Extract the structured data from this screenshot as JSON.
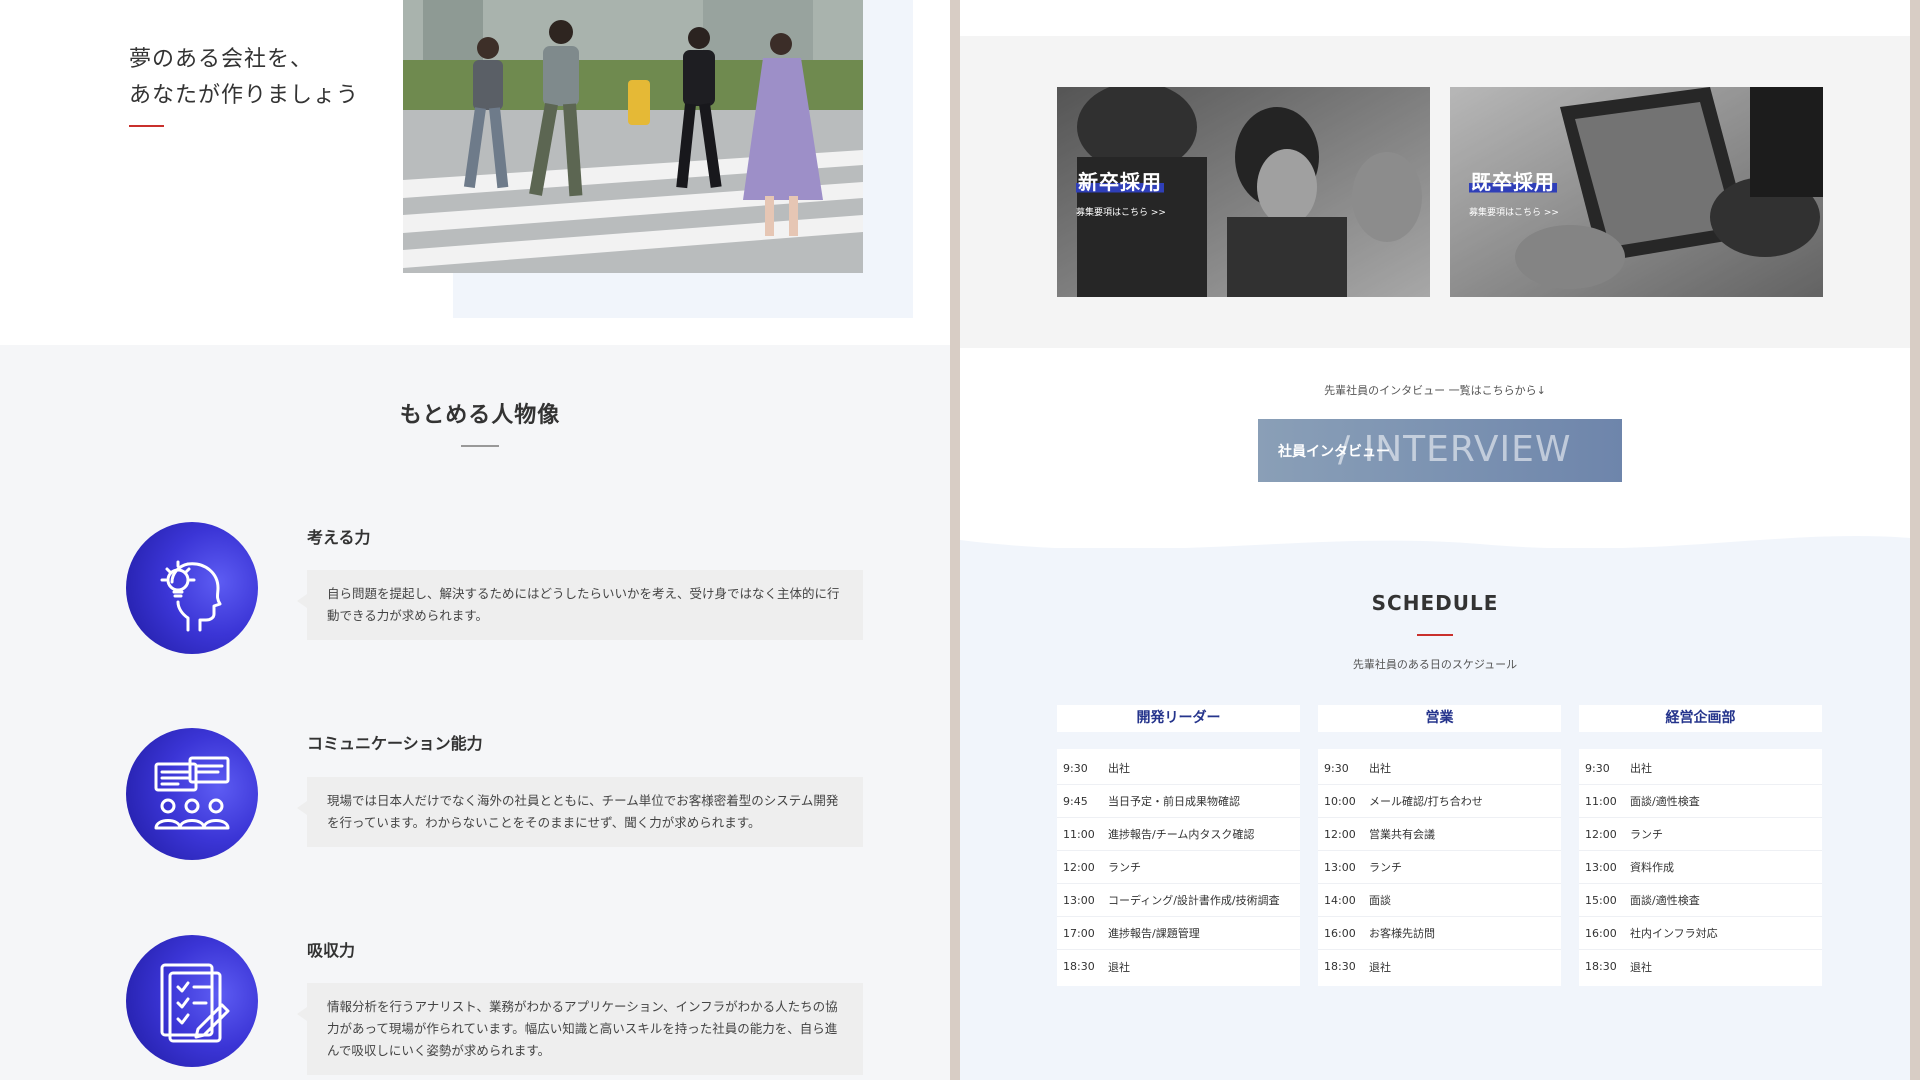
{
  "left": {
    "hero": {
      "title_line1": "夢のある会社を、",
      "title_line2": "あなたが作りましょう"
    },
    "section_title": "もとめる人物像",
    "traits": [
      {
        "name": "考える力",
        "icon": "lightbulb-head-icon",
        "text": "自ら問題を提起し、解決するためにはどうしたらいいかを考え、受け身ではなく主体的に行動できる力が求められます。"
      },
      {
        "name": "コミュニケーション能力",
        "icon": "group-chat-icon",
        "text": "現場では日本人だけでなく海外の社員とともに、チーム単位でお客様密着型のシステム開発を行っています。わからないことをそのままにせず、聞く力が求められます。"
      },
      {
        "name": "吸収力",
        "icon": "checklist-pen-icon",
        "text": "情報分析を行うアナリスト、業務がわかるアプリケーション、インフラがわかる人たちの協力があって現場が作られています。幅広い知識と高いスキルを持った社員の能力を、自ら進んで吸収しにいく姿勢が求められます。"
      }
    ]
  },
  "right": {
    "recruit": [
      {
        "label": "新卒採用",
        "sub": "募集要項はこちら >>"
      },
      {
        "label": "既卒採用",
        "sub": "募集要項はこちら >>"
      }
    ],
    "interview": {
      "note": "先輩社員のインタビュー 一覧はこちらから↓",
      "button_label": "社員インタビュー",
      "button_big": "/ INTERVIEW"
    },
    "schedule": {
      "title": "SCHEDULE",
      "subtitle": "先輩社員のある日のスケジュール",
      "columns": [
        {
          "title": "開発リーダー",
          "rows": [
            {
              "time": "9:30",
              "event": "出社"
            },
            {
              "time": "9:45",
              "event": "当日予定・前日成果物確認"
            },
            {
              "time": "11:00",
              "event": "進捗報告/チーム内タスク確認"
            },
            {
              "time": "12:00",
              "event": "ランチ"
            },
            {
              "time": "13:00",
              "event": "コーディング/設計書作成/技術調査"
            },
            {
              "time": "17:00",
              "event": "進捗報告/課題管理"
            },
            {
              "time": "18:30",
              "event": "退社"
            }
          ]
        },
        {
          "title": "営業",
          "rows": [
            {
              "time": "9:30",
              "event": "出社"
            },
            {
              "time": "10:00",
              "event": "メール確認/打ち合わせ"
            },
            {
              "time": "12:00",
              "event": "営業共有会議"
            },
            {
              "time": "13:00",
              "event": "ランチ"
            },
            {
              "time": "14:00",
              "event": "面談"
            },
            {
              "time": "16:00",
              "event": "お客様先訪問"
            },
            {
              "time": "18:30",
              "event": "退社"
            }
          ]
        },
        {
          "title": "経営企画部",
          "rows": [
            {
              "time": "9:30",
              "event": "出社"
            },
            {
              "time": "11:00",
              "event": "面談/適性検査"
            },
            {
              "time": "12:00",
              "event": "ランチ"
            },
            {
              "time": "13:00",
              "event": "資料作成"
            },
            {
              "time": "15:00",
              "event": "面談/適性検査"
            },
            {
              "time": "16:00",
              "event": "社内インフラ対応"
            },
            {
              "time": "18:30",
              "event": "退社"
            }
          ]
        }
      ]
    }
  }
}
